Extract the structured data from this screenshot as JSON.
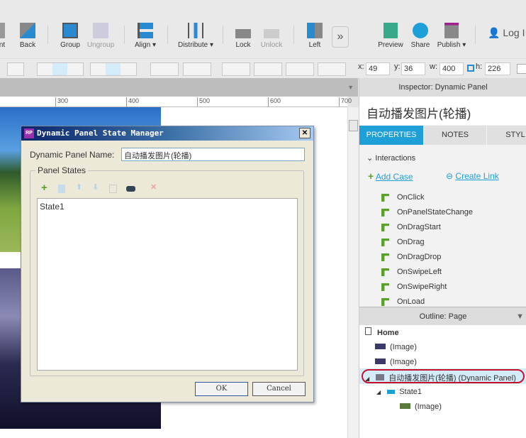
{
  "toolbar": {
    "items": [
      {
        "label": "nt",
        "icon": "front-icon"
      },
      {
        "label": "Back",
        "icon": "back-icon"
      },
      {
        "label": "Group",
        "icon": "group-icon"
      },
      {
        "label": "Ungroup",
        "icon": "ungroup-icon"
      },
      {
        "label": "Align ▾",
        "icon": "align-icon"
      },
      {
        "label": "Distribute ▾",
        "icon": "distribute-icon"
      },
      {
        "label": "Lock",
        "icon": "lock-icon"
      },
      {
        "label": "Unlock",
        "icon": "unlock-icon"
      },
      {
        "label": "Left",
        "icon": "left-panel-icon"
      },
      {
        "label": "Preview",
        "icon": "preview-icon"
      },
      {
        "label": "Share",
        "icon": "share-icon"
      },
      {
        "label": "Publish ▾",
        "icon": "publish-icon"
      }
    ],
    "more": "»",
    "login": "Log I"
  },
  "format": {
    "x_label": "x:",
    "x": "49",
    "y_label": "y:",
    "y": "36",
    "w_label": "w:",
    "w": "400",
    "h_label": "h:",
    "h": "226"
  },
  "ruler": [
    "300",
    "400",
    "500",
    "600",
    "700"
  ],
  "inspector": {
    "title": "Inspector: Dynamic Panel",
    "name": "自动播发图片(轮播)",
    "tabs": [
      "PROPERTIES",
      "NOTES",
      "STYL"
    ],
    "section": "Interactions",
    "add_case": "Add Case",
    "create_link": "Create Link",
    "events": [
      "OnClick",
      "OnPanelStateChange",
      "OnDragStart",
      "OnDrag",
      "OnDragDrop",
      "OnSwipeLeft",
      "OnSwipeRight",
      "OnLoad"
    ]
  },
  "outline": {
    "title": "Outline: Page",
    "home": "Home",
    "items": [
      "(Image)",
      "(Image)",
      "自动播发图片(轮播) (Dynamic Panel)",
      "State1",
      "(Image)"
    ]
  },
  "dialog": {
    "title": "Dynamic Panel State Manager",
    "name_label": "Dynamic Panel Name:",
    "name_value": "自动播发图片(轮播)",
    "states_label": "Panel States",
    "states": [
      "State1"
    ],
    "ok": "OK",
    "cancel": "Cancel",
    "close": "✕"
  },
  "colors": {
    "accent": "#1e9fd8",
    "highlight": "#c8102e",
    "green": "#5aa02c"
  }
}
